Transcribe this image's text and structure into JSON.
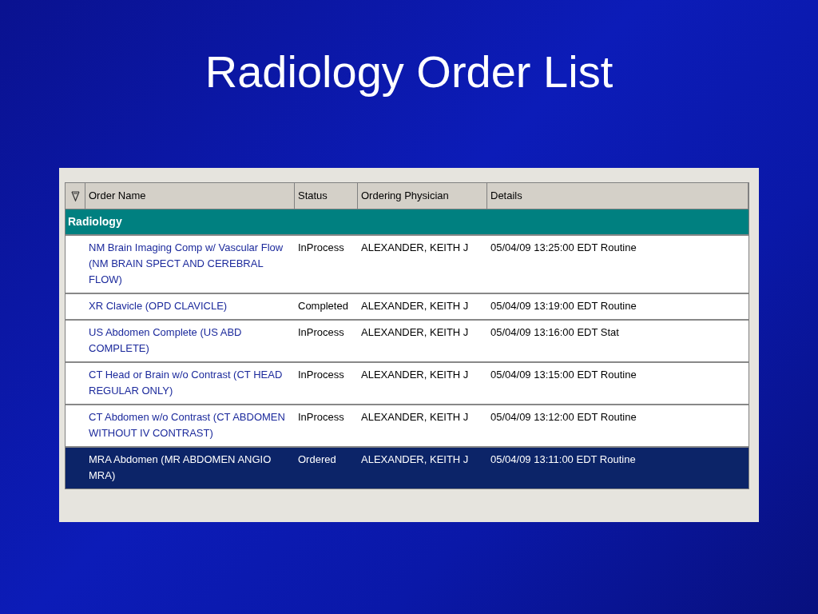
{
  "slide": {
    "title": "Radiology Order List"
  },
  "table": {
    "columns": [
      "Order Name",
      "Status",
      "Ordering Physician",
      "Details"
    ],
    "group": "Radiology",
    "rows": [
      {
        "order_name": "NM Brain Imaging Comp w/ Vascular Flow (NM BRAIN SPECT AND CEREBRAL FLOW)",
        "status": "InProcess",
        "physician": "ALEXANDER, KEITH J",
        "details": "05/04/09 13:25:00 EDT Routine",
        "selected": false
      },
      {
        "order_name": "XR Clavicle (OPD CLAVICLE)",
        "status": "Completed",
        "physician": "ALEXANDER, KEITH J",
        "details": "05/04/09 13:19:00 EDT Routine",
        "selected": false
      },
      {
        "order_name": "US Abdomen Complete (US ABD COMPLETE)",
        "status": "InProcess",
        "physician": "ALEXANDER, KEITH J",
        "details": "05/04/09 13:16:00 EDT Stat",
        "selected": false
      },
      {
        "order_name": "CT Head or Brain w/o Contrast (CT HEAD REGULAR ONLY)",
        "status": "InProcess",
        "physician": "ALEXANDER, KEITH J",
        "details": "05/04/09 13:15:00 EDT Routine",
        "selected": false
      },
      {
        "order_name": "CT Abdomen w/o Contrast (CT ABDOMEN WITHOUT IV CONTRAST)",
        "status": "InProcess",
        "physician": "ALEXANDER, KEITH J",
        "details": "05/04/09 13:12:00 EDT Routine",
        "selected": false
      },
      {
        "order_name": "MRA Abdomen (MR ABDOMEN ANGIO MRA)",
        "status": "Ordered",
        "physician": "ALEXANDER, KEITH J",
        "details": "05/04/09 13:11:00 EDT Routine",
        "selected": true
      }
    ]
  }
}
